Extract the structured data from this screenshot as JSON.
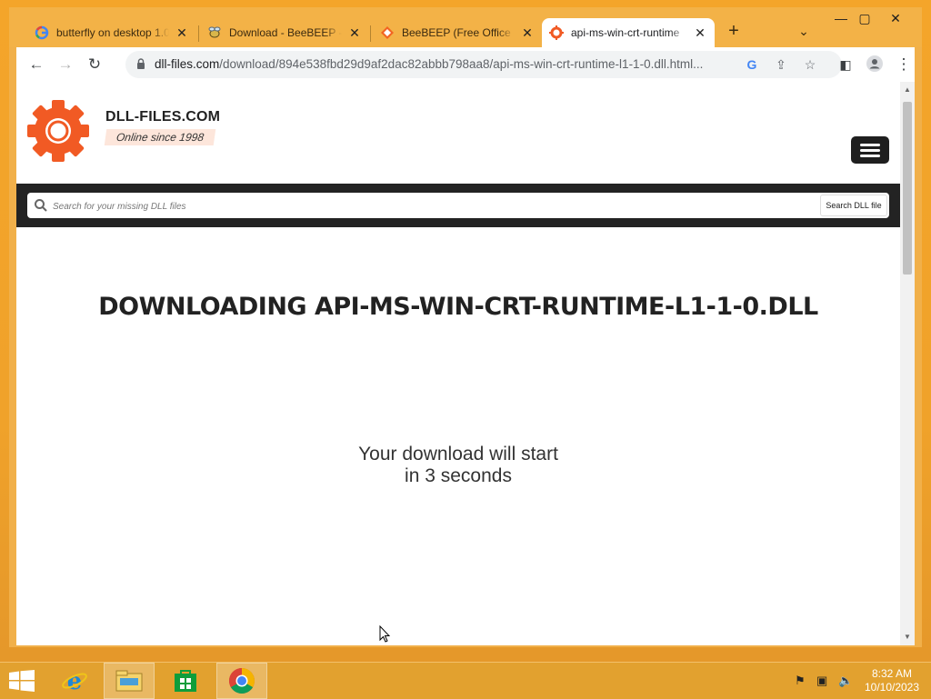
{
  "colors": {
    "desktop": "#f0a22a",
    "titlebar": "#f3b247",
    "accent_logo": "#f15a24",
    "search_band": "#232323"
  },
  "tabs": [
    {
      "label": "butterfly on desktop 1.0",
      "icon": "google-icon"
    },
    {
      "label": "Download - BeeBEEP - F",
      "icon": "beebeep-icon"
    },
    {
      "label": "BeeBEEP (Free Office M",
      "icon": "sourceforge-icon"
    },
    {
      "label": "api-ms-win-crt-runtime",
      "icon": "dll-files-icon"
    }
  ],
  "address": {
    "host": "dll-files.com",
    "path": "/download/894e538fbd29d9af2dac82abbb798aa8/api-ms-win-crt-runtime-l1-1-0.dll.html..."
  },
  "site": {
    "brand": "DLL-FILES.COM",
    "tagline": "Online since 1998",
    "search_placeholder": "Search for your missing DLL files",
    "search_button": "Search DLL file"
  },
  "main": {
    "title": "DOWNLOADING API-MS-WIN-CRT-RUNTIME-L1-1-0.DLL",
    "message_line1": "Your download will start",
    "message_line2": "in 3 seconds"
  },
  "taskbar": {
    "apps": [
      "internet-explorer",
      "file-explorer",
      "store",
      "chrome"
    ],
    "time": "8:32 AM",
    "date": "10/10/2023"
  }
}
